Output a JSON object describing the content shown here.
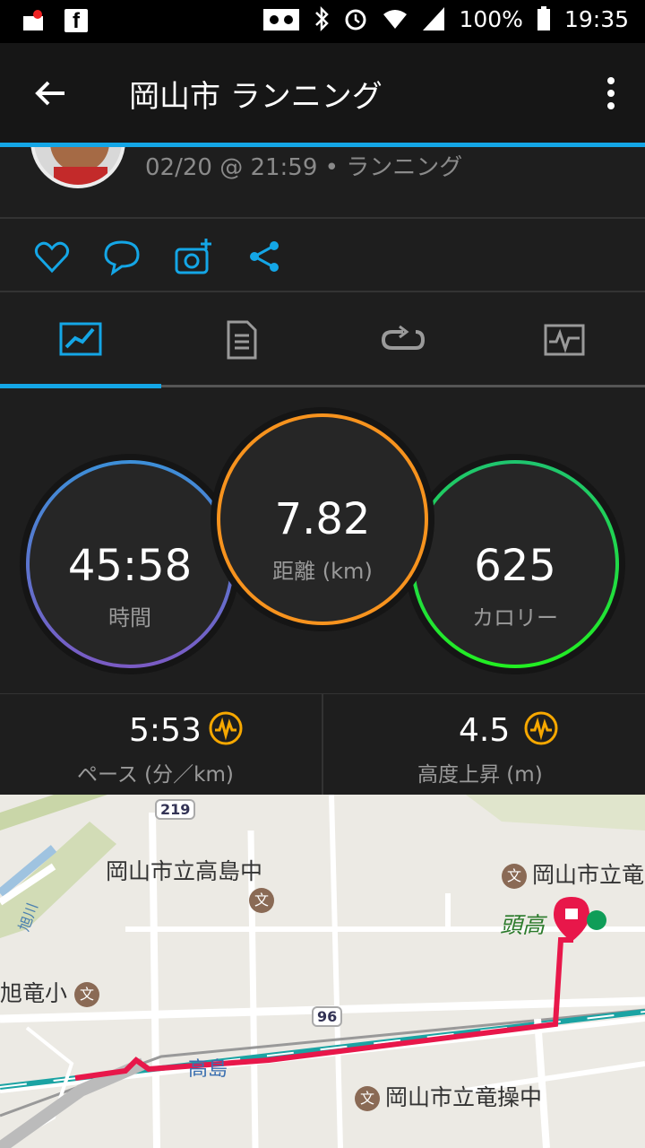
{
  "status_bar": {
    "battery": "100%",
    "time": "19:35",
    "icons": [
      "notification-icon",
      "facebook-icon",
      "voicemail-icon",
      "bluetooth-icon",
      "alarm-icon",
      "wifi-icon",
      "signal-icon",
      "battery-icon"
    ]
  },
  "app_bar": {
    "title": "岡山市 ランニング",
    "back_icon": "arrow-back-icon",
    "menu_icon": "more-vert-icon"
  },
  "activity": {
    "meta": "02/20 @ 21:59 • ランニング"
  },
  "social": {
    "icons": [
      "heart-icon",
      "comment-icon",
      "add-photo-icon",
      "share-icon"
    ]
  },
  "tabs": [
    {
      "icon": "map-overview-icon",
      "active": true
    },
    {
      "icon": "details-list-icon",
      "active": false
    },
    {
      "icon": "laps-icon",
      "active": false
    },
    {
      "icon": "chart-icon",
      "active": false
    }
  ],
  "stats": {
    "time": {
      "value": "45:58",
      "label": "時間"
    },
    "distance": {
      "value": "7.82",
      "label": "距離 (km)"
    },
    "calories": {
      "value": "625",
      "label": "カロリー"
    }
  },
  "sub_stats": {
    "pace": {
      "value": "5:53",
      "label": "ペース (分／km)"
    },
    "elevation": {
      "value": "4.5",
      "label": "高度上昇 (m)"
    }
  },
  "colors": {
    "accent": "#14a6e6",
    "time_ring": "#3d8fd8",
    "distance_ring": "#f7931e",
    "calories_ring": "#22dd44",
    "perf_icon": "#f7a800",
    "route": "#e8174a"
  },
  "map": {
    "labels": {
      "takashima_jhs": "岡山市立高島中",
      "okayama_school": "岡山市立竜",
      "tokoko": "頭高",
      "asahi_es": "旭竜小",
      "takashima_station": "高島",
      "ryuso_jhs": "岡山市立竜操中",
      "river": "旭川"
    },
    "route_shields": [
      "219",
      "96"
    ],
    "school_symbol": "文"
  }
}
